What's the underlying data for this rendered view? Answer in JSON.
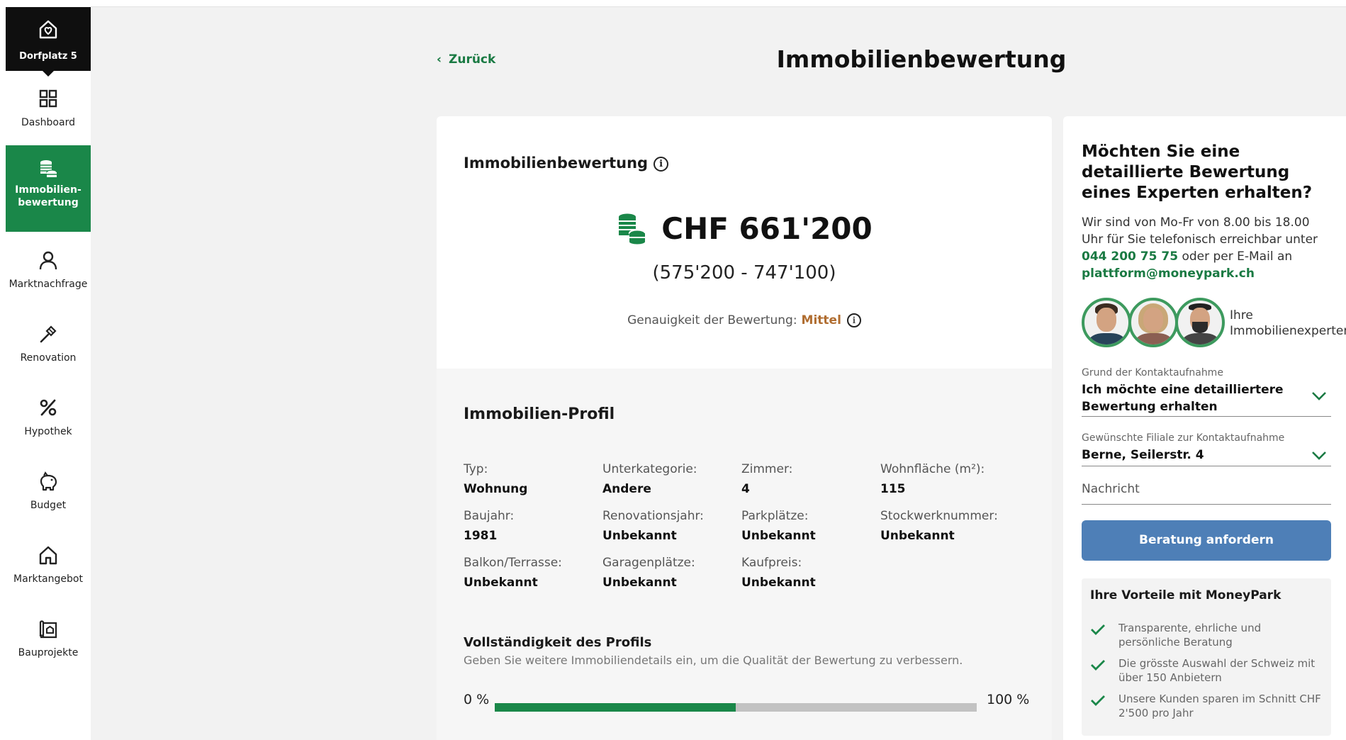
{
  "sidebar": {
    "home": {
      "label": "Dorfplatz 5",
      "icon": "house-heart-icon"
    },
    "items": [
      {
        "label": "Dashboard",
        "icon": "grid-icon"
      },
      {
        "label": "Immobilien-\nbewertung",
        "icon": "coins-icon",
        "active": true
      },
      {
        "label": "Marktnachfrage",
        "icon": "person-icon"
      },
      {
        "label": "Renovation",
        "icon": "hammer-icon"
      },
      {
        "label": "Hypothek",
        "icon": "percent-icon"
      },
      {
        "label": "Budget",
        "icon": "piggy-bank-icon"
      },
      {
        "label": "Marktangebot",
        "icon": "house-icon"
      },
      {
        "label": "Bauprojekte",
        "icon": "blueprint-icon"
      }
    ]
  },
  "header": {
    "back_label": "Zurück",
    "title": "Immobilienbewertung"
  },
  "valuation": {
    "title": "Immobilienbewertung",
    "amount": "CHF 661'200",
    "range": "(575'200 - 747'100)",
    "accuracy_label": "Genauigkeit der Bewertung:",
    "accuracy_value": "Mittel"
  },
  "profile": {
    "title": "Immobilien-Profil",
    "fields": [
      {
        "label": "Typ:",
        "value": "Wohnung"
      },
      {
        "label": "Unterkategorie:",
        "value": "Andere"
      },
      {
        "label": "Zimmer:",
        "value": "4"
      },
      {
        "label": "Wohnfläche (m²):",
        "value": "115"
      },
      {
        "label": "Baujahr:",
        "value": "1981"
      },
      {
        "label": "Renovationsjahr:",
        "value": "Unbekannt"
      },
      {
        "label": "Parkplätze:",
        "value": "Unbekannt"
      },
      {
        "label": "Stockwerknummer:",
        "value": "Unbekannt"
      },
      {
        "label": "Balkon/Terrasse:",
        "value": "Unbekannt"
      },
      {
        "label": "Garagenplätze:",
        "value": "Unbekannt"
      },
      {
        "label": "Kaufpreis:",
        "value": "Unbekannt"
      }
    ],
    "completeness_title": "Vollständigkeit des Profils",
    "completeness_hint": "Geben Sie weitere Immobiliendetails ein, um die Qualität der Bewertung zu verbessern.",
    "bar_min_label": "0 %",
    "bar_max_label": "100 %",
    "completeness_fraction": 0.5
  },
  "contact": {
    "title": "Möchten Sie eine detaillierte Bewertung eines Experten erhalten?",
    "text_1": "Wir sind von Mo-Fr von 8.00 bis 18.00 Uhr für Sie telefonisch erreichbar unter",
    "phone": "044 200 75 75",
    "text_2": "oder per E-Mail an",
    "email": "plattform@moneypark.ch",
    "experts_label_1": "Ihre",
    "experts_label_2": "Immobilienexperten",
    "reason_label": "Grund der Kontaktaufnahme",
    "reason_value": "Ich möchte eine detailliertere Bewertung erhalten",
    "branch_label": "Gewünschte Filiale zur Kontaktaufnahme",
    "branch_value": "Berne, Seilerstr. 4",
    "message_placeholder": "Nachricht",
    "submit_label": "Beratung anfordern",
    "advantages_title": "Ihre Vorteile mit MoneyPark",
    "advantages": [
      "Transparente, ehrliche und persönliche Beratung",
      "Die grösste Auswahl der Schweiz mit über 150 Anbietern",
      "Unsere Kunden sparen im Schnitt CHF 2'500 pro Jahr"
    ]
  },
  "colors": {
    "brand_green": "#1a8749",
    "accent_blue": "#4e7fb7",
    "accuracy_orange": "#b06d30"
  }
}
